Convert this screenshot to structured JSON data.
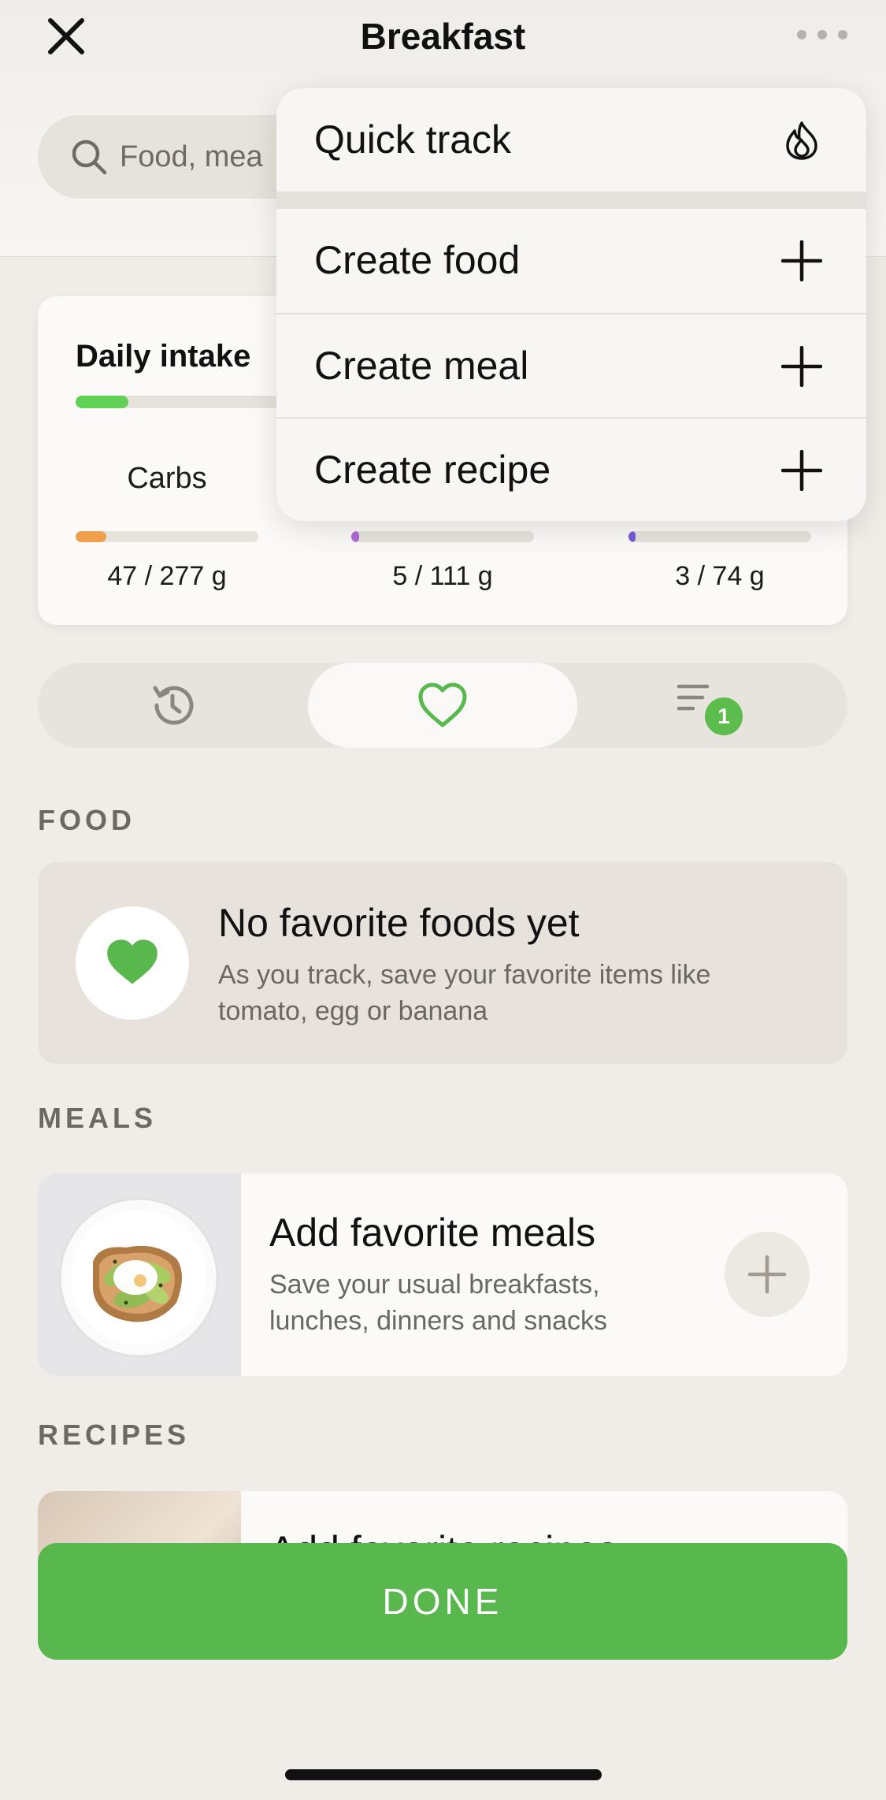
{
  "header": {
    "title": "Breakfast",
    "search_placeholder": "Food, mea"
  },
  "menu": {
    "items": [
      {
        "label": "Quick track",
        "icon": "flame-icon"
      },
      {
        "label": "Create food",
        "icon": "plus-icon"
      },
      {
        "label": "Create meal",
        "icon": "plus-icon"
      },
      {
        "label": "Create recipe",
        "icon": "plus-icon"
      }
    ]
  },
  "intake": {
    "title": "Daily intake",
    "progress": 0.23,
    "macros": [
      {
        "name": "Carbs",
        "value": "47 / 277 g",
        "progress": 0.17,
        "color": "#f0a04b"
      },
      {
        "name": "",
        "value": "5 / 111 g",
        "progress": 0.045,
        "color": "#b06ad8"
      },
      {
        "name": "",
        "value": "3 / 74 g",
        "progress": 0.04,
        "color": "#7a5ad8"
      }
    ]
  },
  "tabs": {
    "items": [
      "history-icon",
      "heart-icon",
      "list-icon"
    ],
    "active": 1,
    "badge": "1"
  },
  "food": {
    "heading": "FOOD",
    "title": "No favorite foods yet",
    "subtitle_line1": "As you track, save your favorite items like",
    "subtitle_line2": "tomato, egg or banana"
  },
  "meals": {
    "heading": "MEALS",
    "title": "Add favorite meals",
    "subtitle_line1": "Save your usual breakfasts,",
    "subtitle_line2": "lunches, dinners and snacks"
  },
  "recipes": {
    "heading": "RECIPES",
    "title": "Add favorite recipes"
  },
  "done_label": "DONE",
  "colors": {
    "accent_green": "#58b74d",
    "carbs": "#f0a04b",
    "protein": "#b06ad8",
    "fat": "#7a5ad8"
  }
}
